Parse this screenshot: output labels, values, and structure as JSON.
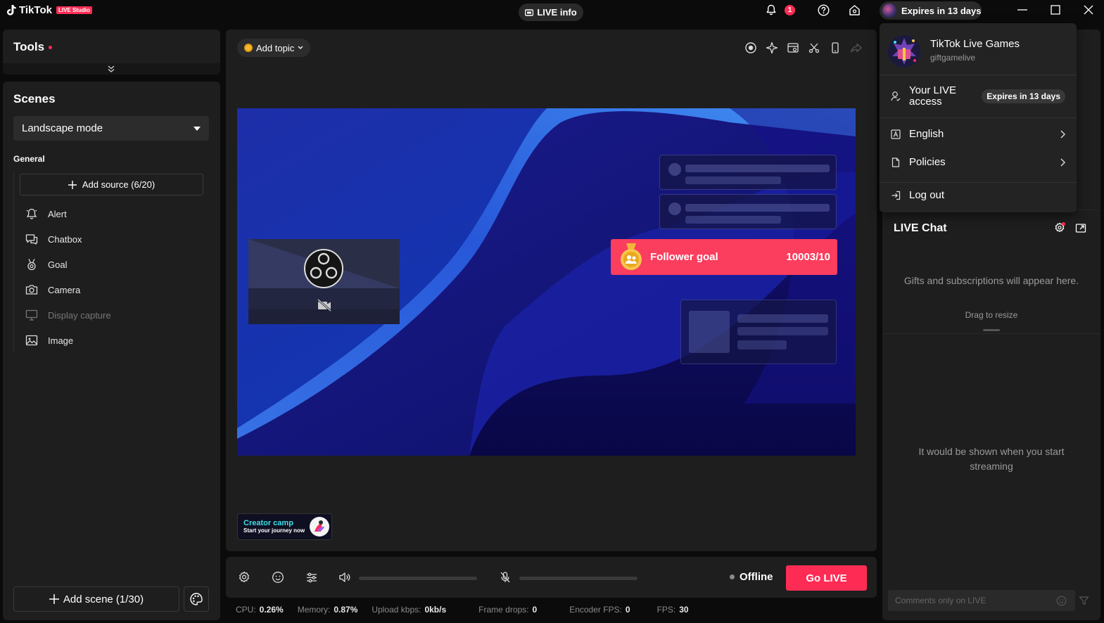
{
  "titlebar": {
    "app_name": "TikTok",
    "studio_badge": "LIVE Studio",
    "live_info": "LIVE info",
    "notification_count": "1",
    "expires_pill": "Expires in 13 days"
  },
  "tools": {
    "title": "Tools"
  },
  "scenes": {
    "title": "Scenes",
    "mode": "Landscape mode",
    "section_label": "General",
    "add_source": "Add source (6/20)",
    "sources": [
      {
        "label": "Alert",
        "icon": "bell-icon",
        "enabled": true
      },
      {
        "label": "Chatbox",
        "icon": "chatbox-icon",
        "enabled": true
      },
      {
        "label": "Goal",
        "icon": "medal-icon",
        "enabled": true
      },
      {
        "label": "Camera",
        "icon": "camera-icon",
        "enabled": true
      },
      {
        "label": "Display capture",
        "icon": "monitor-icon",
        "enabled": false
      },
      {
        "label": "Image",
        "icon": "image-icon",
        "enabled": true
      }
    ],
    "add_scene": "Add scene (1/30)"
  },
  "canvas": {
    "add_topic": "Add topic",
    "follower_goal": {
      "label": "Follower goal",
      "value": "10003/10"
    },
    "creator_camp": {
      "title": "Creator camp",
      "subtitle": "Start your journey now"
    }
  },
  "controls": {
    "status": "Offline",
    "go_live": "Go LIVE"
  },
  "stats": [
    {
      "label": "CPU:",
      "value": "0.26%"
    },
    {
      "label": "Memory:",
      "value": "0.87%"
    },
    {
      "label": "Upload kbps:",
      "value": "0kb/s"
    },
    {
      "label": "Frame drops:",
      "value": "0"
    },
    {
      "label": "Encoder FPS:",
      "value": "0"
    },
    {
      "label": "FPS:",
      "value": "30"
    }
  ],
  "chat": {
    "title": "LIVE Chat",
    "gifts_message": "Gifts and subscriptions will appear here.",
    "drag_hint": "Drag to resize",
    "empty_message": "It would be shown when you start streaming",
    "input_placeholder": "Comments only on LIVE"
  },
  "account_menu": {
    "name": "TikTok Live Games",
    "handle": "giftgamelive",
    "access_label": "Your LIVE access",
    "access_expiry": "Expires in 13 days",
    "language": "English",
    "policies": "Policies",
    "logout": "Log out"
  },
  "colors": {
    "accent": "#fe2c55",
    "panel": "#1e1e1e",
    "background": "#0b0b0b"
  }
}
